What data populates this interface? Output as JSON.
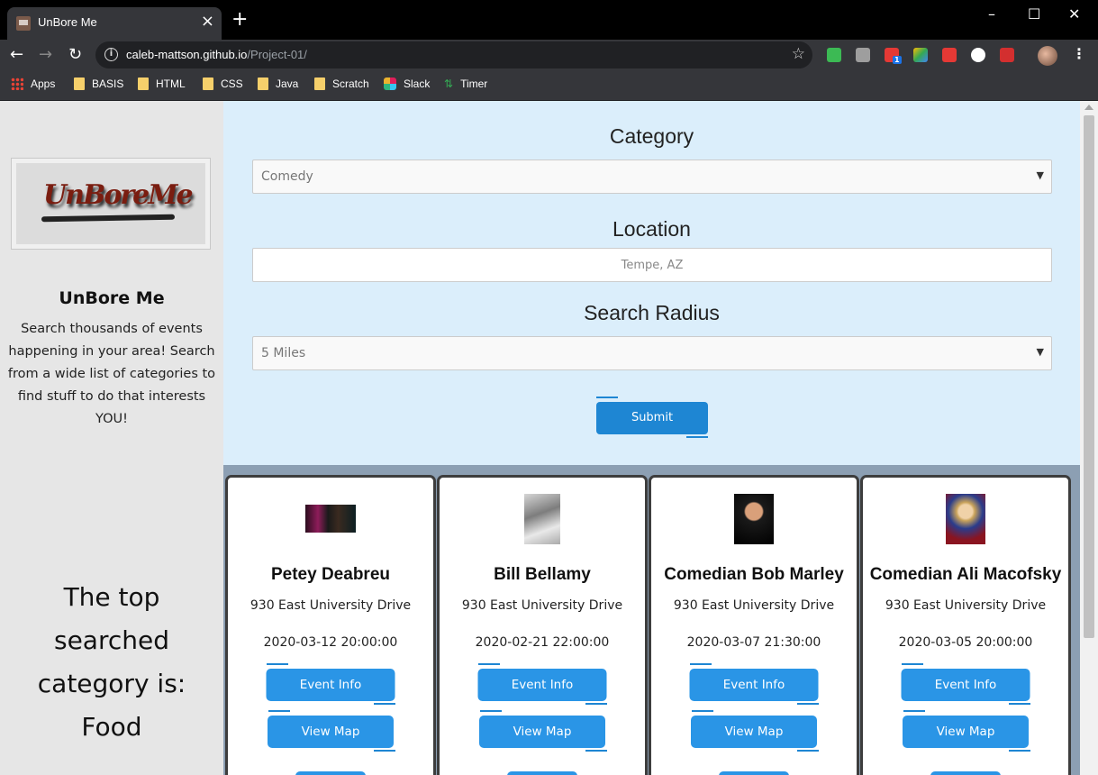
{
  "browser": {
    "tab_title": "UnBore Me",
    "url_host": "caleb-mattson.github.io",
    "url_path": "/Project-01/",
    "bookmarks": [
      "Apps",
      "BASIS",
      "HTML",
      "CSS",
      "Java",
      "Scratch",
      "Slack",
      "Timer"
    ],
    "extension_badge": "1"
  },
  "sidebar": {
    "title": "UnBore Me",
    "logo_text": "UnBoreMe",
    "description": "Search thousands of events happening in your area! Search from a wide list of categories to find stuff to do that interests YOU!",
    "top_category_line1": "The top",
    "top_category_line2": "searched",
    "top_category_line3": "category is:",
    "top_category_value": "Food"
  },
  "form": {
    "category_label": "Category",
    "category_value": "Comedy",
    "location_label": "Location",
    "location_placeholder": "Tempe, AZ",
    "radius_label": "Search Radius",
    "radius_value": "5 Miles",
    "submit_label": "Submit"
  },
  "events": [
    {
      "title": "Petey Deabreu",
      "address": "930 East University Drive",
      "date": "2020-03-12 20:00:00",
      "info_label": "Event Info",
      "map_label": "View Map"
    },
    {
      "title": "Bill Bellamy",
      "address": "930 East University Drive",
      "date": "2020-02-21 22:00:00",
      "info_label": "Event Info",
      "map_label": "View Map"
    },
    {
      "title": "Comedian Bob Marley",
      "address": "930 East University Drive",
      "date": "2020-03-07 21:30:00",
      "info_label": "Event Info",
      "map_label": "View Map"
    },
    {
      "title": "Comedian Ali Macofsky",
      "address": "930 East University Drive",
      "date": "2020-03-05 20:00:00",
      "info_label": "Event Info",
      "map_label": "View Map"
    }
  ],
  "colors": {
    "accent": "#1e86d3",
    "form_bg": "#dbeefb",
    "results_bg": "#8c9fb3",
    "sidebar_bg": "#e6e6e6"
  }
}
